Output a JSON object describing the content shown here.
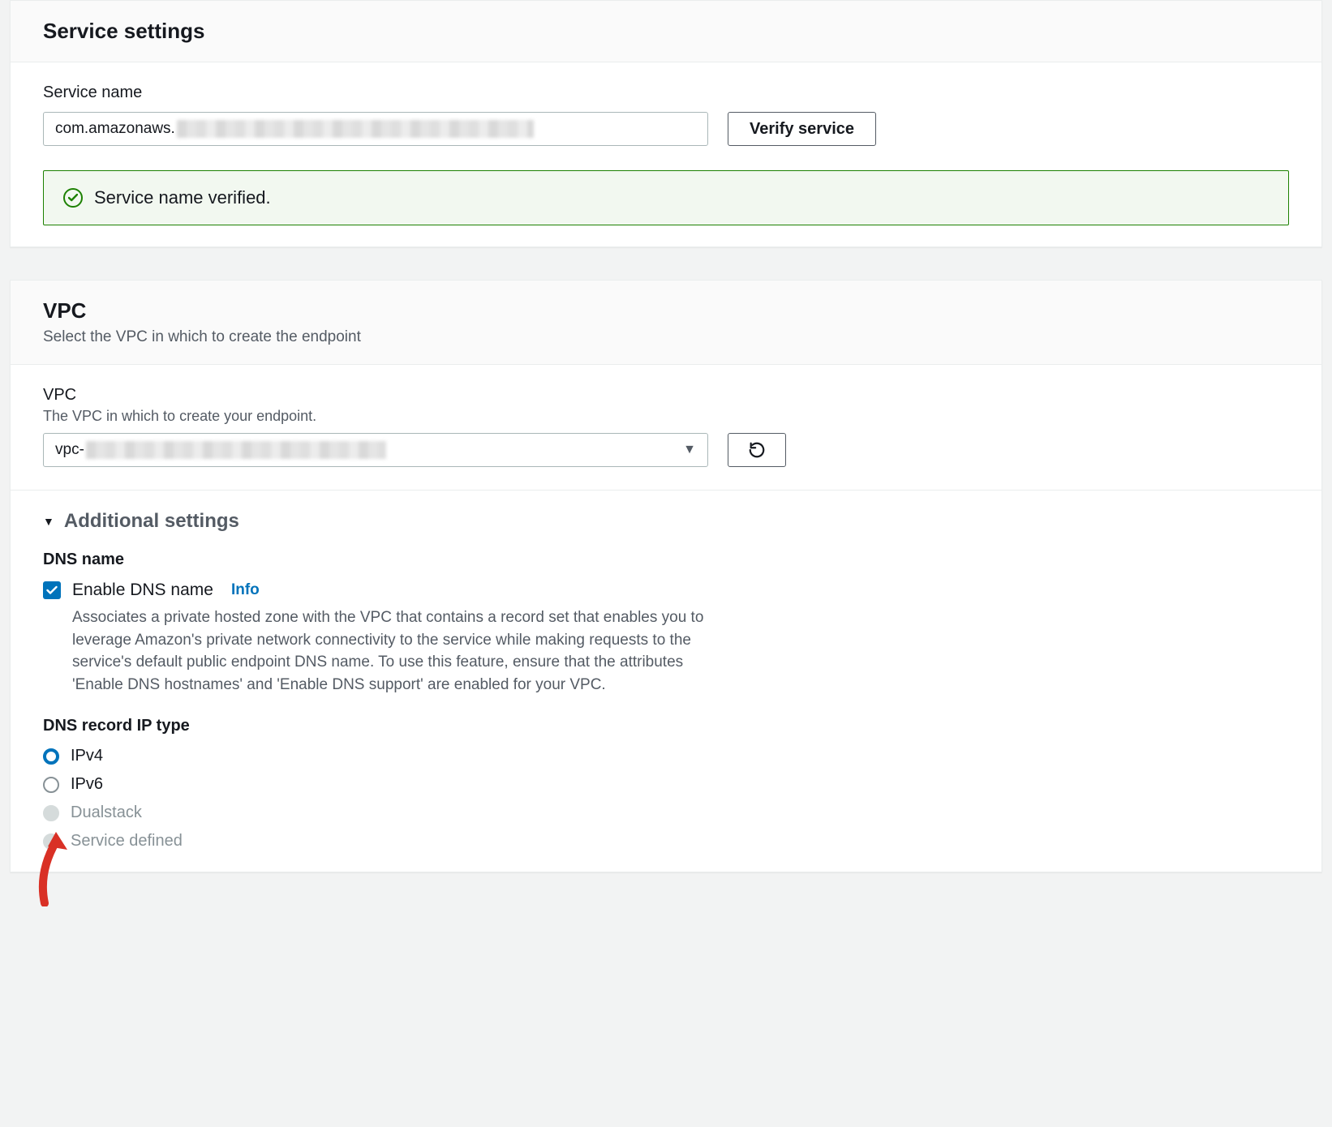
{
  "service_settings": {
    "title": "Service settings",
    "name_label": "Service name",
    "name_prefix": "com.amazonaws.",
    "verify_button": "Verify service",
    "verified_message": "Service name verified."
  },
  "vpc": {
    "title": "VPC",
    "subtitle": "Select the VPC in which to create the endpoint",
    "field_label": "VPC",
    "field_help": "The VPC in which to create your endpoint.",
    "select_prefix": "vpc-",
    "additional_settings_label": "Additional settings",
    "dns": {
      "section_label": "DNS name",
      "checkbox_label": "Enable DNS name",
      "info_label": "Info",
      "description": "Associates a private hosted zone with the VPC that contains a record set that enables you to leverage Amazon's private network connectivity to the service while making requests to the service's default public endpoint DNS name. To use this feature, ensure that the attributes 'Enable DNS hostnames' and 'Enable DNS support' are enabled for your VPC."
    },
    "ip_type": {
      "section_label": "DNS record IP type",
      "options": {
        "ipv4": "IPv4",
        "ipv6": "IPv6",
        "dualstack": "Dualstack",
        "service_defined": "Service defined"
      }
    }
  }
}
